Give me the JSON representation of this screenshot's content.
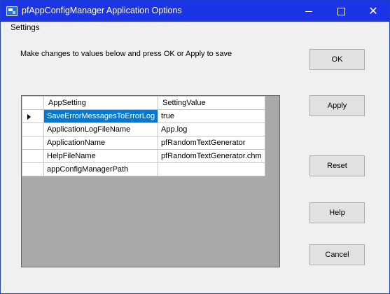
{
  "window": {
    "title": "pfAppConfigManager Application Options",
    "close_glyph": "✕"
  },
  "menu": {
    "items": [
      "Settings"
    ]
  },
  "instructions": "Make changes to values below and press OK or Apply to save",
  "grid": {
    "columns": [
      "AppSetting",
      "SettingValue"
    ],
    "rows": [
      {
        "setting": "SaveErrorMessagesToErrorLog",
        "value": "true"
      },
      {
        "setting": "ApplicationLogFileName",
        "value": "App.log"
      },
      {
        "setting": "ApplicationName",
        "value": "pfRandomTextGenerator"
      },
      {
        "setting": "HelpFileName",
        "value": "pfRandomTextGenerator.chm"
      },
      {
        "setting": "appConfigManagerPath",
        "value": ""
      }
    ],
    "selected_row": 0
  },
  "buttons": {
    "ok": "OK",
    "apply": "Apply",
    "reset": "Reset",
    "help": "Help",
    "cancel": "Cancel"
  },
  "colors": {
    "titlebar": "#1c34e8",
    "selection": "#0078d7",
    "grid_background": "#a9a9a9"
  },
  "icons": [
    "app-icon",
    "minimize-icon",
    "maximize-icon",
    "close-icon",
    "row-pointer-icon"
  ]
}
